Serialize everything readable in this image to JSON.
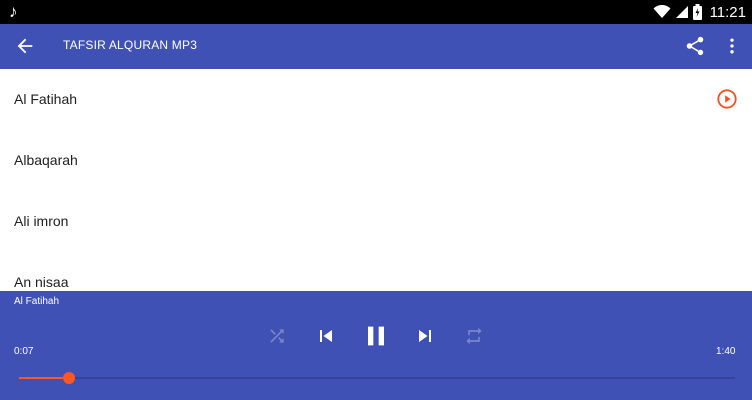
{
  "status_bar": {
    "time": "11:21",
    "icons": [
      "music-note-icon",
      "wifi-icon",
      "signal-icon",
      "battery-icon"
    ]
  },
  "app_bar": {
    "title": "TAFSIR ALQURAN MP3",
    "back_icon": "arrow-back-icon",
    "share_icon": "share-icon",
    "more_icon": "more-vert-icon",
    "color": "#3f51b5"
  },
  "list": {
    "items": [
      {
        "label": "Al Fatihah",
        "playing": true
      },
      {
        "label": "Albaqarah"
      },
      {
        "label": "Ali imron"
      },
      {
        "label": "An nisaa"
      }
    ],
    "play_icon_color": "#f4511e"
  },
  "player": {
    "now_playing": "Al Fatihah",
    "current_time": "0:07",
    "duration": "1:40",
    "progress": 0.07,
    "accent": "#ff5722",
    "controls": [
      "shuffle-icon",
      "skip-previous-icon",
      "pause-icon",
      "skip-next-icon",
      "repeat-icon"
    ]
  }
}
